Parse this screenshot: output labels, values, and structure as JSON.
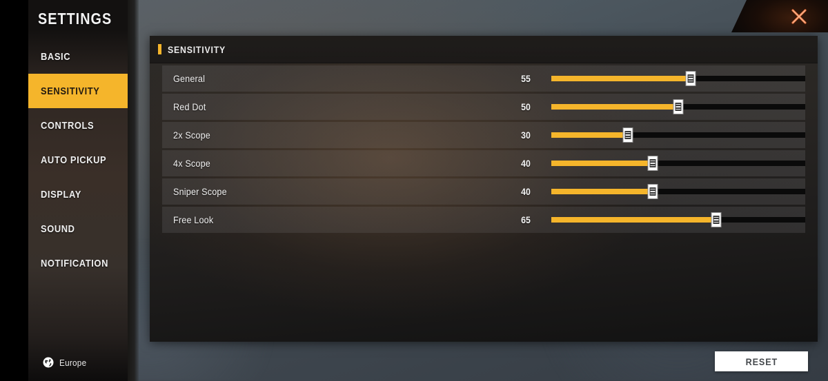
{
  "window": {
    "title": "SETTINGS",
    "close_icon": "close-x-icon",
    "accent_color": "#f5b52b",
    "close_color": "#e8733f"
  },
  "sidebar": {
    "items": [
      {
        "label": "BASIC",
        "active": false
      },
      {
        "label": "SENSITIVITY",
        "active": true
      },
      {
        "label": "CONTROLS",
        "active": false
      },
      {
        "label": "AUTO PICKUP",
        "active": false
      },
      {
        "label": "DISPLAY",
        "active": false
      },
      {
        "label": "SOUND",
        "active": false
      },
      {
        "label": "NOTIFICATION",
        "active": false
      }
    ],
    "region": {
      "icon": "globe-icon",
      "label": "Europe"
    }
  },
  "panel": {
    "header_title": "SENSITIVITY",
    "rows": [
      {
        "label": "General",
        "value": "55",
        "percent": 55
      },
      {
        "label": "Red Dot",
        "value": "50",
        "percent": 50
      },
      {
        "label": "2x Scope",
        "value": "30",
        "percent": 30
      },
      {
        "label": "4x Scope",
        "value": "40",
        "percent": 40
      },
      {
        "label": "Sniper Scope",
        "value": "40",
        "percent": 40
      },
      {
        "label": "Free Look",
        "value": "65",
        "percent": 65
      }
    ]
  },
  "footer": {
    "reset_label": "RESET"
  }
}
